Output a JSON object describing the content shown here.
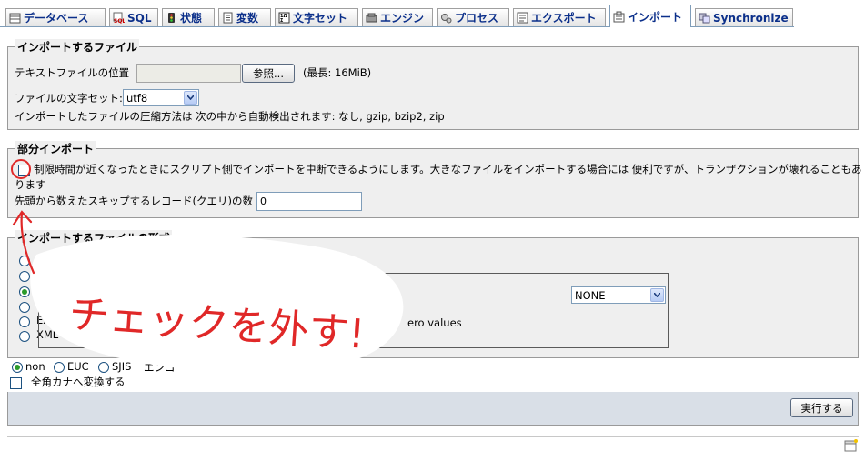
{
  "tabs": [
    {
      "label": "データベース",
      "icon": "database-icon"
    },
    {
      "label": "SQL",
      "icon": "sql-icon"
    },
    {
      "label": "状態",
      "icon": "status-icon"
    },
    {
      "label": "変数",
      "icon": "variables-icon"
    },
    {
      "label": "文字セット",
      "icon": "charset-icon"
    },
    {
      "label": "エンジン",
      "icon": "engine-icon"
    },
    {
      "label": "プロセス",
      "icon": "process-icon"
    },
    {
      "label": "エクスポート",
      "icon": "export-icon"
    },
    {
      "label": "インポート",
      "icon": "import-icon"
    },
    {
      "label": "Synchronize",
      "icon": "synchronize-icon"
    }
  ],
  "active_tab": "インポート",
  "file_section": {
    "legend": "インポートするファイル",
    "location_label": "テキストファイルの位置",
    "location_value": "",
    "browse_button": "参照...",
    "max_size": "(最長: 16MiB)",
    "charset_label": "ファイルの文字セット:",
    "charset_value": "utf8",
    "compression_note": "インポートしたファイルの圧縮方法は 次の中から自動検出されます: なし, gzip, bzip2, zip"
  },
  "partial_section": {
    "legend": "部分インポート",
    "interrupt_label_line1": "制限時間が近くなったときにスクリプト側でインポートを中断できるようにします。大きなファイルをインポートする場合には 便利ですが、トランザクションが壊れることもあ",
    "interrupt_label_line2": "ります",
    "interrupt_checked": false,
    "skip_label": "先頭から数えたスキップするレコード(クエリ)の数",
    "skip_value": "0"
  },
  "format_section": {
    "legend": "インポートするファイルの形式",
    "formats": [
      {
        "label": "C",
        "selected": false
      },
      {
        "label": "",
        "selected": false
      },
      {
        "label": "",
        "selected": true
      },
      {
        "label": "",
        "selected": false
      },
      {
        "label": "Exc",
        "selected": false
      },
      {
        "label": "XML",
        "selected": false
      }
    ],
    "compat_value": "NONE",
    "zero_values_fragment": "ero values"
  },
  "encoding": {
    "options": [
      {
        "label": "non",
        "selected": true
      },
      {
        "label": "EUC",
        "selected": false
      },
      {
        "label": "SJIS",
        "selected": false
      }
    ],
    "fragment": "エンコ",
    "kana_label": "全角カナへ変換する",
    "kana_checked": false
  },
  "submit_button": "実行する",
  "annotation": {
    "text": "チェックを外す!",
    "color": "#e02828"
  }
}
